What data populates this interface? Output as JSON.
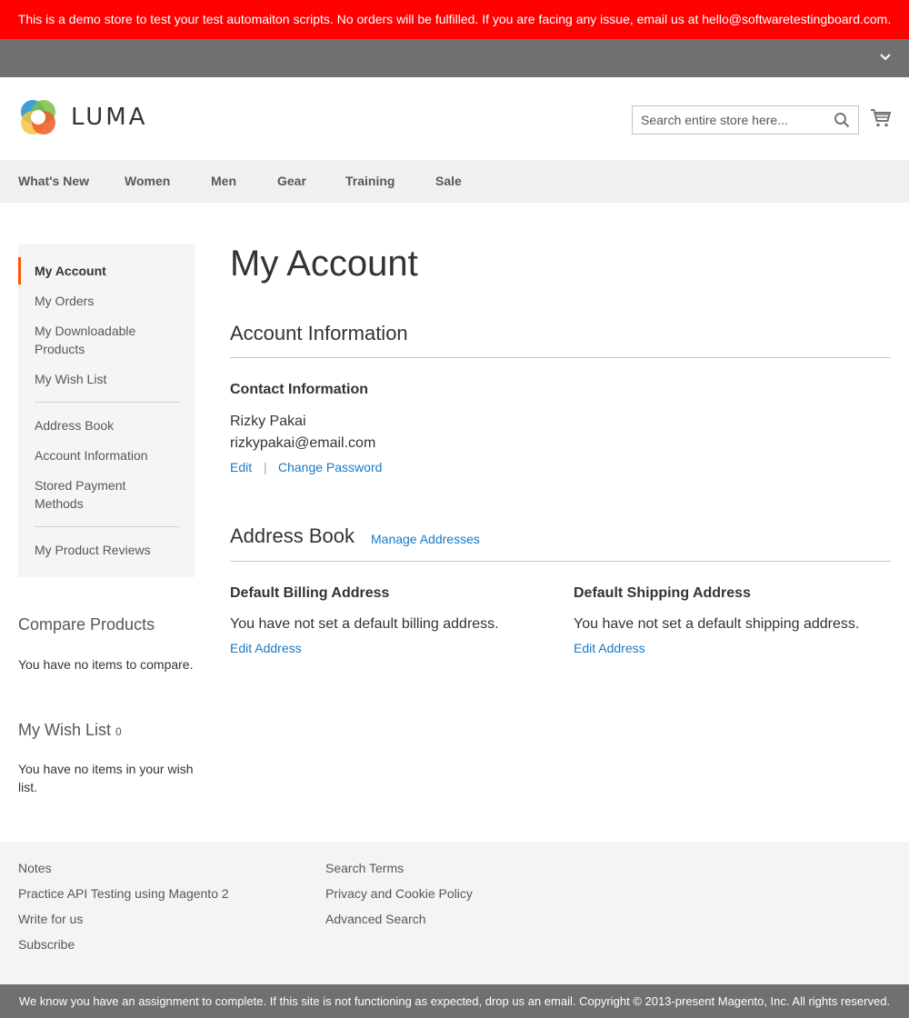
{
  "demo_notice": "This is a demo store to test your test automaiton scripts. No orders will be fulfilled. If you are facing any issue, email us at hello@softwaretestingboard.com.",
  "header": {
    "logo_text": "LUMA",
    "search_placeholder": "Search entire store here...",
    "search_icon": "search-icon",
    "cart_icon": "cart-icon"
  },
  "nav": {
    "items": [
      "What's New",
      "Women",
      "Men",
      "Gear",
      "Training",
      "Sale"
    ]
  },
  "sidebar": {
    "items": [
      "My Account",
      "My Orders",
      "My Downloadable Products",
      "My Wish List",
      "Address Book",
      "Account Information",
      "Stored Payment Methods",
      "My Product Reviews"
    ],
    "active": "My Account"
  },
  "compare": {
    "title": "Compare Products",
    "empty": "You have no items to compare."
  },
  "wishlist": {
    "title": "My Wish List",
    "count": "0",
    "empty": "You have no items in your wish list."
  },
  "main": {
    "page_title": "My Account",
    "account_info": {
      "title": "Account Information",
      "contact_title": "Contact Information",
      "name": "Rizky Pakai",
      "email": "rizkypakai@email.com",
      "edit_label": "Edit",
      "change_password_label": "Change Password"
    },
    "address_book": {
      "title": "Address Book",
      "manage_label": "Manage Addresses",
      "billing_title": "Default Billing Address",
      "billing_text": "You have not set a default billing address.",
      "shipping_title": "Default Shipping Address",
      "shipping_text": "You have not set a default shipping address.",
      "edit_address_label": "Edit Address"
    }
  },
  "footer": {
    "col1": [
      "Notes",
      "Practice API Testing using Magento 2",
      "Write for us",
      "Subscribe"
    ],
    "col2": [
      "Search Terms",
      "Privacy and Cookie Policy",
      "Advanced Search"
    ],
    "copyright": "We know you have an assignment to complete. If this site is not functioning as expected, drop us an email. Copyright © 2013-present Magento, Inc. All rights reserved."
  },
  "colors": {
    "demo_bar": "#ff0101",
    "panel": "#6e716e",
    "link": "#1979c3",
    "active_marker": "#ff5501"
  }
}
